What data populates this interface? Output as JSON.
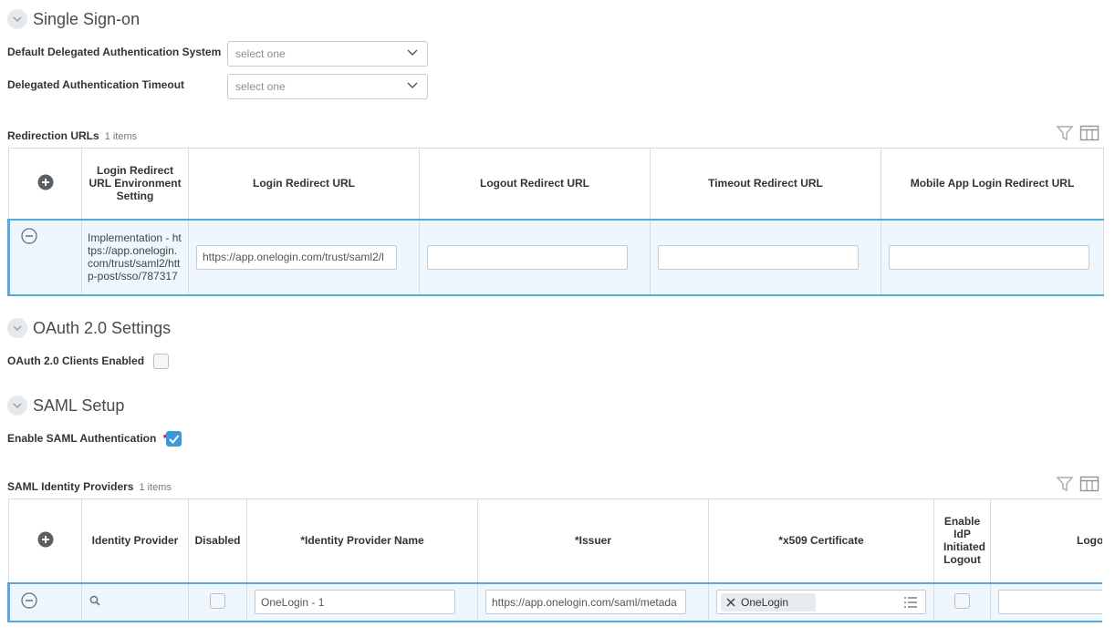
{
  "sso": {
    "title": "Single Sign-on",
    "delegated_system_label": "Default Delegated Authentication System",
    "delegated_system_placeholder": "select one",
    "delegated_timeout_label": "Delegated Authentication Timeout",
    "delegated_timeout_placeholder": "select one"
  },
  "redirection": {
    "title": "Redirection URLs",
    "count": "1 items",
    "columns": [
      "Login Redirect URL Environment Setting",
      "Login Redirect URL",
      "Logout Redirect URL",
      "Timeout Redirect URL",
      "Mobile App Login Redirect URL"
    ],
    "row": {
      "environment": "Implementation - https://app.onelogin.com/trust/saml2/http-post/sso/787317",
      "login_url": "https://app.onelogin.com/trust/saml2/l",
      "logout_url": "",
      "timeout_url": "",
      "mobile_url": ""
    }
  },
  "oauth": {
    "title": "OAuth 2.0 Settings",
    "clients_label": "OAuth 2.0 Clients Enabled",
    "clients_enabled": false
  },
  "saml": {
    "title": "SAML Setup",
    "enable_label": "Enable SAML Authentication",
    "required_mark": "*",
    "enabled": true
  },
  "idp": {
    "title": "SAML Identity Providers",
    "count": "1 items",
    "columns": [
      "Identity Provider",
      "Disabled",
      "*Identity Provider Name",
      "*Issuer",
      "*x509 Certificate",
      "Enable IdP Initiated Logout",
      "Logout Res"
    ],
    "row": {
      "name": "OneLogin - 1",
      "issuer": "https://app.onelogin.com/saml/metada",
      "certificate": "OneLogin",
      "logout_response": ""
    }
  },
  "colors": {
    "accent": "#3a99d8",
    "selected_row_bg": "#eef7fd",
    "required": "#d0021b"
  }
}
